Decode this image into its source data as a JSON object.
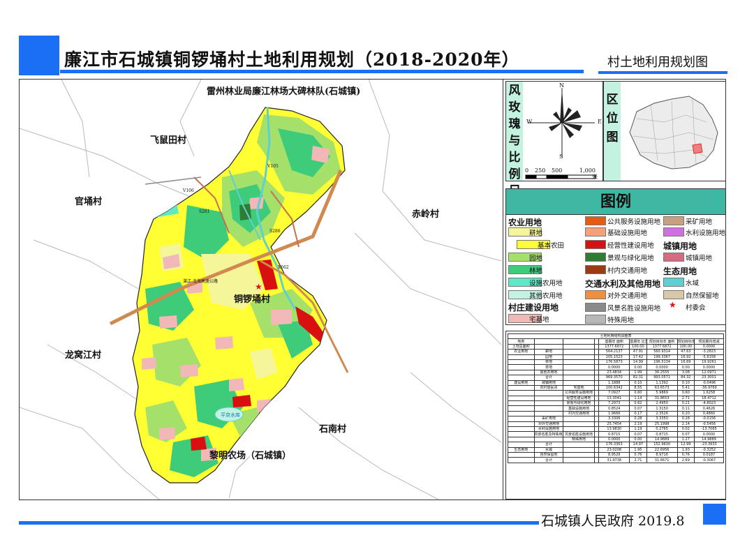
{
  "header": {
    "title": "廉江市石城镇铜锣埇村土地利用规划（2018-2020年）",
    "subtitle": "村土地利用规划图",
    "footer": "石城镇人民政府 2019.8"
  },
  "map": {
    "labels": {
      "north_unit": "雷州林业局廉江林场大碑林队(石城镇)",
      "feishu": "飞鼠田村",
      "guanyong": "官埇村",
      "chiling": "赤岭村",
      "longwo": "龙窝江村",
      "shinan": "石南村",
      "liming": "黎明农场（石城镇）",
      "center": "铜锣埇村",
      "reservoir": "平京水库",
      "road_v106": "V106",
      "road_v105": "V105",
      "road_s281": "S281",
      "road_s286": "S286",
      "road_x662": "X662",
      "highway": "湛江-北海高速公路"
    }
  },
  "inset": {
    "compass_title": "风玫瑰与比例尺",
    "n": "N",
    "s": "S",
    "e": "E",
    "w": "W",
    "scale_ticks": [
      "0",
      "250",
      "500",
      "1,000"
    ],
    "scale_unit": "米",
    "location_title": "区位图"
  },
  "legend": {
    "title": "图例",
    "groups": {
      "agri": "农业用地",
      "village": "村庄建设用地",
      "transport": "交通水利及其他用地",
      "town": "城镇用地",
      "eco": "生态用地"
    },
    "items": [
      {
        "label": "耕地",
        "color": "#f5f59a"
      },
      {
        "label": "基本农田",
        "color": "#ffff33"
      },
      {
        "label": "园地",
        "color": "#a4e06a"
      },
      {
        "label": "林地",
        "color": "#3fcc7a"
      },
      {
        "label": "设施农用地",
        "color": "#5fe8c8"
      },
      {
        "label": "其他农用地",
        "color": "#c4f2e0"
      },
      {
        "label": "宅基地",
        "color": "#f2b8b8"
      },
      {
        "label": "公共服务设施用地",
        "color": "#e85a10"
      },
      {
        "label": "基础设施用地",
        "color": "#f4a07a"
      },
      {
        "label": "经营性建设用地",
        "color": "#d81010"
      },
      {
        "label": "景观与绿化用地",
        "color": "#2e7d32"
      },
      {
        "label": "村内交通用地",
        "color": "#9c3a12"
      },
      {
        "label": "对外交通用地",
        "color": "#ef8f3c"
      },
      {
        "label": "风景名胜设施用地",
        "color": "#8a8a8a"
      },
      {
        "label": "特殊用地",
        "color": "#b8b8b8"
      },
      {
        "label": "采矿用地",
        "color": "#c8a080"
      },
      {
        "label": "水利设施用地",
        "color": "#d070e0"
      },
      {
        "label": "城镇用地",
        "color": "#d46c80"
      },
      {
        "label": "水域",
        "color": "#5ed0d0"
      },
      {
        "label": "自然保留地",
        "color": "#d8c8a8"
      },
      {
        "label": "村委会",
        "color": "#e01010"
      }
    ]
  },
  "table": {
    "title": "土地利用结构调整表",
    "headers": [
      "地类",
      "",
      "",
      "",
      "基期年 面积",
      "基期年 比重",
      "规划目标年 面积",
      "规划目标年 比重",
      "规划期内增减"
    ],
    "rows": [
      [
        "土地总面积",
        "",
        "",
        "",
        "1377.6872",
        "100.00",
        "1377.6872",
        "100.00",
        "0.0000"
      ],
      [
        "农业用地",
        "耕地",
        "",
        "",
        "564.2137",
        "47.91",
        "560.9314",
        "47.63",
        "-3.2823"
      ],
      [
        "",
        "园地",
        "",
        "",
        "205.1523",
        "17.42",
        "199.3367",
        "16.92",
        "-5.8158"
      ],
      [
        "",
        "林地",
        "",
        "",
        "176.5873",
        "14.99",
        "196.5134",
        "16.69",
        "19.9261"
      ],
      [
        "",
        "草地",
        "",
        "",
        "0.0000",
        "0.00",
        "0.0000",
        "0.00",
        "0.0000"
      ],
      [
        "",
        "其他农用地",
        "",
        "",
        "23.4834",
        "1.99",
        "36.2555",
        "3.08",
        "12.0971"
      ],
      [
        "",
        "合计",
        "",
        "",
        "969.3570",
        "82.31",
        "993.0571",
        "84.32",
        "23.3001"
      ],
      [
        "建设用地",
        "城镇用地",
        "",
        "",
        "1.1888",
        "0.10",
        "1.1392",
        "0.10",
        "-0.0496"
      ],
      [
        "",
        "农村居民点",
        "宅基地",
        "",
        "100.6342",
        "8.55",
        "63.6573",
        "5.41",
        "-36.9769"
      ],
      [
        "",
        "",
        "公共服务设施用地",
        "",
        "7.0927",
        "0.60",
        "5.9869",
        "0.60",
        "1.6258"
      ],
      [
        "",
        "",
        "经营性建设用地",
        "",
        "13.3041",
        "1.14",
        "31.8653",
        "2.71",
        "18.4712"
      ],
      [
        "",
        "",
        "景观与绿化用地",
        "",
        "7.2973",
        "0.62",
        "2.4950",
        "0.21",
        "-4.8023"
      ],
      [
        "",
        "",
        "基础设施用地",
        "",
        "0.8524",
        "0.07",
        "1.3150",
        "0.11",
        "0.4626"
      ],
      [
        "",
        "",
        "村内交通用地",
        "",
        "1.9666",
        "0.17",
        "2.3526",
        "0.20",
        "0.4860"
      ],
      [
        "",
        "采矿用地",
        "",
        "",
        "3.3306",
        "0.28",
        "3.3350",
        "0.28",
        "-0.0156"
      ],
      [
        "",
        "对外交通用地",
        "",
        "",
        "25.7454",
        "2.19",
        "25.1998",
        "2.14",
        "-0.5456"
      ],
      [
        "",
        "水利设施用地",
        "",
        "",
        "13.9830",
        "1.19",
        "0.2765",
        "0.02",
        "-13.7065"
      ],
      [
        "",
        "风景名胜及特殊用地",
        "风景名胜设施用地",
        "",
        "0.8715",
        "0.07",
        "0.8715",
        "0.07",
        "0.0000"
      ],
      [
        "",
        "",
        "特殊用地",
        "",
        "0.0000",
        "0.00",
        "14.9889",
        "1.27",
        "14.9889"
      ],
      [
        "",
        "合计",
        "",
        "",
        "176.3363",
        "14.97",
        "152.9630",
        "12.99",
        "-23.3933"
      ],
      [
        "生态用地",
        "水域",
        "",
        "",
        "23.0208",
        "1.95",
        "22.6956",
        "1.93",
        "-0.3252"
      ],
      [
        "",
        "自然保留地",
        "",
        "",
        "8.9529",
        "0.76",
        "8.9716",
        "0.76",
        "0.0187"
      ],
      [
        "",
        "合计",
        "",
        "",
        "31.9738",
        "2.71",
        "31.6671",
        "2.69",
        "-0.3067"
      ]
    ]
  }
}
